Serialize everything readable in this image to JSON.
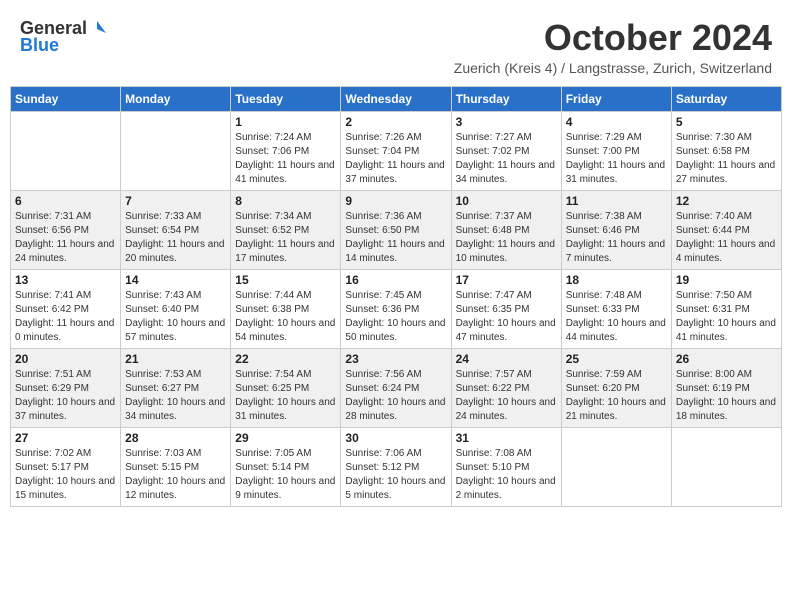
{
  "logo": {
    "general": "General",
    "blue": "Blue"
  },
  "title": "October 2024",
  "subtitle": "Zuerich (Kreis 4) / Langstrasse, Zurich, Switzerland",
  "weekdays": [
    "Sunday",
    "Monday",
    "Tuesday",
    "Wednesday",
    "Thursday",
    "Friday",
    "Saturday"
  ],
  "weeks": [
    [
      {
        "day": "",
        "info": ""
      },
      {
        "day": "",
        "info": ""
      },
      {
        "day": "1",
        "info": "Sunrise: 7:24 AM\nSunset: 7:06 PM\nDaylight: 11 hours and 41 minutes."
      },
      {
        "day": "2",
        "info": "Sunrise: 7:26 AM\nSunset: 7:04 PM\nDaylight: 11 hours and 37 minutes."
      },
      {
        "day": "3",
        "info": "Sunrise: 7:27 AM\nSunset: 7:02 PM\nDaylight: 11 hours and 34 minutes."
      },
      {
        "day": "4",
        "info": "Sunrise: 7:29 AM\nSunset: 7:00 PM\nDaylight: 11 hours and 31 minutes."
      },
      {
        "day": "5",
        "info": "Sunrise: 7:30 AM\nSunset: 6:58 PM\nDaylight: 11 hours and 27 minutes."
      }
    ],
    [
      {
        "day": "6",
        "info": "Sunrise: 7:31 AM\nSunset: 6:56 PM\nDaylight: 11 hours and 24 minutes."
      },
      {
        "day": "7",
        "info": "Sunrise: 7:33 AM\nSunset: 6:54 PM\nDaylight: 11 hours and 20 minutes."
      },
      {
        "day": "8",
        "info": "Sunrise: 7:34 AM\nSunset: 6:52 PM\nDaylight: 11 hours and 17 minutes."
      },
      {
        "day": "9",
        "info": "Sunrise: 7:36 AM\nSunset: 6:50 PM\nDaylight: 11 hours and 14 minutes."
      },
      {
        "day": "10",
        "info": "Sunrise: 7:37 AM\nSunset: 6:48 PM\nDaylight: 11 hours and 10 minutes."
      },
      {
        "day": "11",
        "info": "Sunrise: 7:38 AM\nSunset: 6:46 PM\nDaylight: 11 hours and 7 minutes."
      },
      {
        "day": "12",
        "info": "Sunrise: 7:40 AM\nSunset: 6:44 PM\nDaylight: 11 hours and 4 minutes."
      }
    ],
    [
      {
        "day": "13",
        "info": "Sunrise: 7:41 AM\nSunset: 6:42 PM\nDaylight: 11 hours and 0 minutes."
      },
      {
        "day": "14",
        "info": "Sunrise: 7:43 AM\nSunset: 6:40 PM\nDaylight: 10 hours and 57 minutes."
      },
      {
        "day": "15",
        "info": "Sunrise: 7:44 AM\nSunset: 6:38 PM\nDaylight: 10 hours and 54 minutes."
      },
      {
        "day": "16",
        "info": "Sunrise: 7:45 AM\nSunset: 6:36 PM\nDaylight: 10 hours and 50 minutes."
      },
      {
        "day": "17",
        "info": "Sunrise: 7:47 AM\nSunset: 6:35 PM\nDaylight: 10 hours and 47 minutes."
      },
      {
        "day": "18",
        "info": "Sunrise: 7:48 AM\nSunset: 6:33 PM\nDaylight: 10 hours and 44 minutes."
      },
      {
        "day": "19",
        "info": "Sunrise: 7:50 AM\nSunset: 6:31 PM\nDaylight: 10 hours and 41 minutes."
      }
    ],
    [
      {
        "day": "20",
        "info": "Sunrise: 7:51 AM\nSunset: 6:29 PM\nDaylight: 10 hours and 37 minutes."
      },
      {
        "day": "21",
        "info": "Sunrise: 7:53 AM\nSunset: 6:27 PM\nDaylight: 10 hours and 34 minutes."
      },
      {
        "day": "22",
        "info": "Sunrise: 7:54 AM\nSunset: 6:25 PM\nDaylight: 10 hours and 31 minutes."
      },
      {
        "day": "23",
        "info": "Sunrise: 7:56 AM\nSunset: 6:24 PM\nDaylight: 10 hours and 28 minutes."
      },
      {
        "day": "24",
        "info": "Sunrise: 7:57 AM\nSunset: 6:22 PM\nDaylight: 10 hours and 24 minutes."
      },
      {
        "day": "25",
        "info": "Sunrise: 7:59 AM\nSunset: 6:20 PM\nDaylight: 10 hours and 21 minutes."
      },
      {
        "day": "26",
        "info": "Sunrise: 8:00 AM\nSunset: 6:19 PM\nDaylight: 10 hours and 18 minutes."
      }
    ],
    [
      {
        "day": "27",
        "info": "Sunrise: 7:02 AM\nSunset: 5:17 PM\nDaylight: 10 hours and 15 minutes."
      },
      {
        "day": "28",
        "info": "Sunrise: 7:03 AM\nSunset: 5:15 PM\nDaylight: 10 hours and 12 minutes."
      },
      {
        "day": "29",
        "info": "Sunrise: 7:05 AM\nSunset: 5:14 PM\nDaylight: 10 hours and 9 minutes."
      },
      {
        "day": "30",
        "info": "Sunrise: 7:06 AM\nSunset: 5:12 PM\nDaylight: 10 hours and 5 minutes."
      },
      {
        "day": "31",
        "info": "Sunrise: 7:08 AM\nSunset: 5:10 PM\nDaylight: 10 hours and 2 minutes."
      },
      {
        "day": "",
        "info": ""
      },
      {
        "day": "",
        "info": ""
      }
    ]
  ]
}
